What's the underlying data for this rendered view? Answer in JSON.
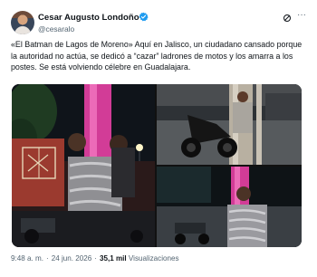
{
  "author": {
    "name": "Cesar Augusto Londoño",
    "handle": "@cesaralo",
    "verified_color": "#1d9bf0",
    "avatar_icon": "profile-photo"
  },
  "header_actions": {
    "grok_icon": "grok-icon",
    "more_icon": "more-options-icon",
    "more_label": "···"
  },
  "tweet": {
    "text": "«El Batman de Lagos de Moreno» Aquí en Jalisco, un ciudadano cansado porque la autoridad no actúa, se dedicó a “cazar” ladrones de motos y los amarra a los postes. Se está volviendo célebre en Guadalajara."
  },
  "media": {
    "photo_count": 3
  },
  "footer": {
    "time": "9:48 a. m.",
    "separator": "·",
    "date": "24 jun. 2026",
    "views_count": "35,1 mil",
    "views_label": "Visualizaciones"
  },
  "colors": {
    "text_primary": "#0f1419",
    "text_secondary": "#536471",
    "accent_pink": "#e0379a"
  }
}
